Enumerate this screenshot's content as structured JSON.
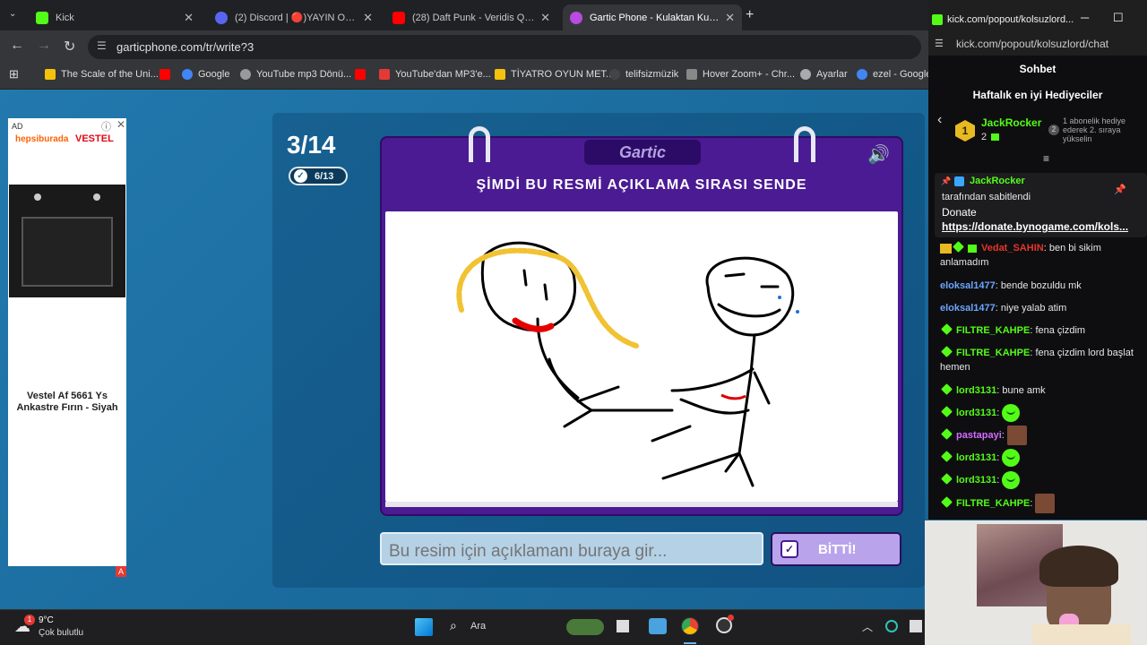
{
  "browser": {
    "tabs": [
      {
        "title": "Kick",
        "color": "#53fc18"
      },
      {
        "title": "(2) Discord | 🔴)YAYIN OD...",
        "color": "#5865f2"
      },
      {
        "title": "(28) Daft Punk - Veridis Quo (M...",
        "color": "#ff0000"
      },
      {
        "title": "Gartic Phone - Kulaktan Kulağa",
        "color": "#b84be0"
      }
    ],
    "new_tab": "+",
    "url": "garticphone.com/tr/write?3",
    "bookmarks": [
      {
        "label": "The Scale of the Uni...",
        "color": "#f4c20d"
      },
      {
        "label": "",
        "color": "#ff0000"
      },
      {
        "label": "Google",
        "color": "#4285f4"
      },
      {
        "label": "YouTube mp3 Dönü...",
        "color": "#999999"
      },
      {
        "label": "",
        "color": "#ff0000"
      },
      {
        "label": "YouTube'dan MP3'e...",
        "color": "#e53935"
      },
      {
        "label": "TİYATRO OYUN MET...",
        "color": "#f4c20d"
      },
      {
        "label": "telifsizmüzik",
        "color": "#333333"
      },
      {
        "label": "Hover Zoom+ - Chr...",
        "color": "#888888"
      },
      {
        "label": "Ayarlar",
        "color": "#aaaaaa"
      },
      {
        "label": "ezel - Google",
        "color": "#4285f4"
      }
    ]
  },
  "ad": {
    "badge": "AD",
    "brand_left": "hepsiburada",
    "brand_right": "VESTEL",
    "product_text": "Vestel Af 5661 Ys Ankastre Fırın - Siyah"
  },
  "game": {
    "round": "3/14",
    "progress": "6/13",
    "logo": "Gartic",
    "prompt": "ŞİMDİ BU RESMİ AÇIKLAMA SIRASI SENDE",
    "answer_placeholder": "Bu resim için açıklamanı buraya gir...",
    "done_label": "BİTTİ!"
  },
  "taskbar": {
    "weather_temp": "9°C",
    "weather_desc": "Çok bulutlu",
    "notification_count": "1",
    "search_label": "Ara"
  },
  "kick": {
    "window_url": "kick.com/popout/kolsuzlord...",
    "address": "kick.com/popout/kolsuzlord/chat",
    "chat_title": "Sohbet",
    "gifters_title": "Haftalık en iyi Hediyeciler",
    "top_gifter": {
      "rank": "1",
      "name": "JackRocker",
      "count": "2"
    },
    "next_rank": {
      "rank": "2",
      "text": "1 abonelik hediye ederek 2. sıraya yükselin"
    },
    "pinned": {
      "user": "JackRocker",
      "by": "tarafından sabitlendi",
      "title": "Donate",
      "link": "https://donate.bynogame.com/kols..."
    },
    "messages": [
      {
        "user": "Vedat_SAHIN",
        "color": "#e5352b",
        "text": "ben bi sikim anlamadım",
        "badge": "star"
      },
      {
        "user": "eloksal1477",
        "color": "#6ba6ff",
        "text": "bende bozuldu mk",
        "badge": ""
      },
      {
        "user": "eloksal1477",
        "color": "#6ba6ff",
        "text": "niye yalab atim",
        "badge": ""
      },
      {
        "user": "FILTRE_KAHPE",
        "color": "#53fc18",
        "text": "fena çizdim",
        "badge": "star"
      },
      {
        "user": "FILTRE_KAHPE",
        "color": "#53fc18",
        "text": "fena çizdim lord başlat hemen",
        "badge": "star"
      },
      {
        "user": "lord3131",
        "color": "#53fc18",
        "text": "bune amk",
        "badge": "star"
      },
      {
        "user": "lord3131",
        "color": "#53fc18",
        "text": "",
        "badge": "star",
        "emote": "emote"
      },
      {
        "user": "pastapayi",
        "color": "#d36bff",
        "text": "",
        "badge": "star",
        "emote": "photo"
      },
      {
        "user": "lord3131",
        "color": "#53fc18",
        "text": "",
        "badge": "star",
        "emote": "emote"
      },
      {
        "user": "lord3131",
        "color": "#53fc18",
        "text": "",
        "badge": "star",
        "emote": "emote"
      },
      {
        "user": "FILTRE_KAHPE",
        "color": "#53fc18",
        "text": "",
        "badge": "star",
        "emote": "photo"
      }
    ]
  }
}
